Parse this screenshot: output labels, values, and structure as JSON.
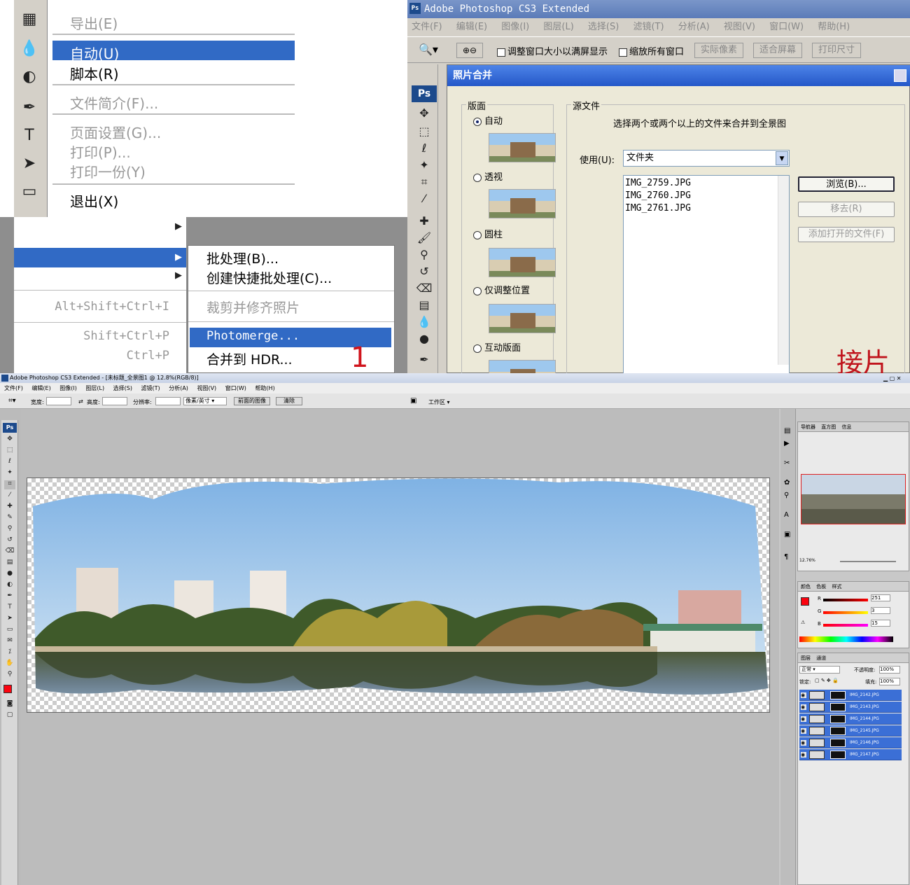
{
  "menu_panel": {
    "file_menu_items": [
      {
        "label": "导出(E)",
        "disabled": true
      },
      {
        "label": "自动(U)",
        "selected": true
      },
      {
        "label": "脚本(R)",
        "disabled": false
      },
      {
        "label": "文件简介(F)...",
        "disabled": true
      },
      {
        "label": "页面设置(G)...",
        "disabled": true
      },
      {
        "label": "打印(P)...",
        "disabled": true
      },
      {
        "label": "打印一份(Y)",
        "disabled": true
      },
      {
        "label": "退出(X)",
        "disabled": false
      }
    ],
    "shortcuts": [
      "Alt+Shift+Ctrl+I",
      "Shift+Ctrl+P",
      "Ctrl+P"
    ],
    "submenu_items": [
      {
        "label": "批处理(B)...",
        "disabled": false
      },
      {
        "label": "创建快捷批处理(C)...",
        "disabled": false
      },
      {
        "label": "裁剪并修齐照片",
        "disabled": true
      },
      {
        "label": "Photomerge...",
        "selected": true
      },
      {
        "label": "合并到 HDR...",
        "disabled": false
      }
    ],
    "annotation_number": "1"
  },
  "ps_top": {
    "title": "Adobe Photoshop CS3 Extended",
    "logo": "Ps",
    "menus": [
      "文件(F)",
      "编辑(E)",
      "图像(I)",
      "图层(L)",
      "选择(S)",
      "滤镜(T)",
      "分析(A)",
      "视图(V)",
      "窗口(W)",
      "帮助(H)"
    ],
    "options": {
      "resize_windows": "调整窗口大小以满屏显示",
      "zoom_all": "缩放所有窗口",
      "actual_pixels": "实际像素",
      "fit_screen": "适合屏幕",
      "print_size": "打印尺寸"
    },
    "dialog": {
      "title": "照片合并",
      "layout_group": "版面",
      "layouts": [
        {
          "label": "自动",
          "checked": true
        },
        {
          "label": "透视",
          "checked": false
        },
        {
          "label": "圆柱",
          "checked": false
        },
        {
          "label": "仅调整位置",
          "checked": false
        },
        {
          "label": "互动版面",
          "checked": false
        }
      ],
      "source_group": "源文件",
      "instruction": "选择两个或两个以上的文件来合并到全景图",
      "use_label": "使用(U):",
      "use_value": "文件夹",
      "files": [
        "IMG_2759.JPG",
        "IMG_2760.JPG",
        "IMG_2761.JPG"
      ],
      "browse_button": "浏览(B)...",
      "remove_button": "移去(R)",
      "add_open_button": "添加打开的文件(F)"
    },
    "red_caption": "接片界"
  },
  "ps_bottom": {
    "title": "Adobe Photoshop CS3 Extended - [未标题_全景图1 @ 12.8%(RGB/8)]",
    "menus": [
      "文件(F)",
      "编辑(E)",
      "图像(I)",
      "图层(L)",
      "选择(S)",
      "滤镜(T)",
      "分析(A)",
      "视图(V)",
      "窗口(W)",
      "帮助(H)"
    ],
    "options": {
      "width_label": "宽度:",
      "height_label": "高度:",
      "resolution_label": "分辨率:",
      "unit": "像素/英寸",
      "front_image": "前面的图像",
      "clear": "清除",
      "workspace": "工作区"
    },
    "navigator_tabs": [
      "导航器",
      "直方图",
      "信息"
    ],
    "zoom": "12.76%",
    "color_tabs": [
      "颜色",
      "色板",
      "样式"
    ],
    "color": {
      "R": "251",
      "G": "3",
      "B": "15",
      "swatch": "#fb030f"
    },
    "layers_tabs": [
      "图层",
      "通道"
    ],
    "blend_mode": "正常",
    "opacity_label": "不透明度:",
    "opacity": "100%",
    "lock_label": "锁定:",
    "fill_label": "填充:",
    "fill": "100%",
    "layers": [
      "IMG_2142.JPG",
      "IMG_2143.JPG",
      "IMG_2144.JPG",
      "IMG_2145.JPG",
      "IMG_2146.JPG",
      "IMG_2147.JPG"
    ]
  }
}
